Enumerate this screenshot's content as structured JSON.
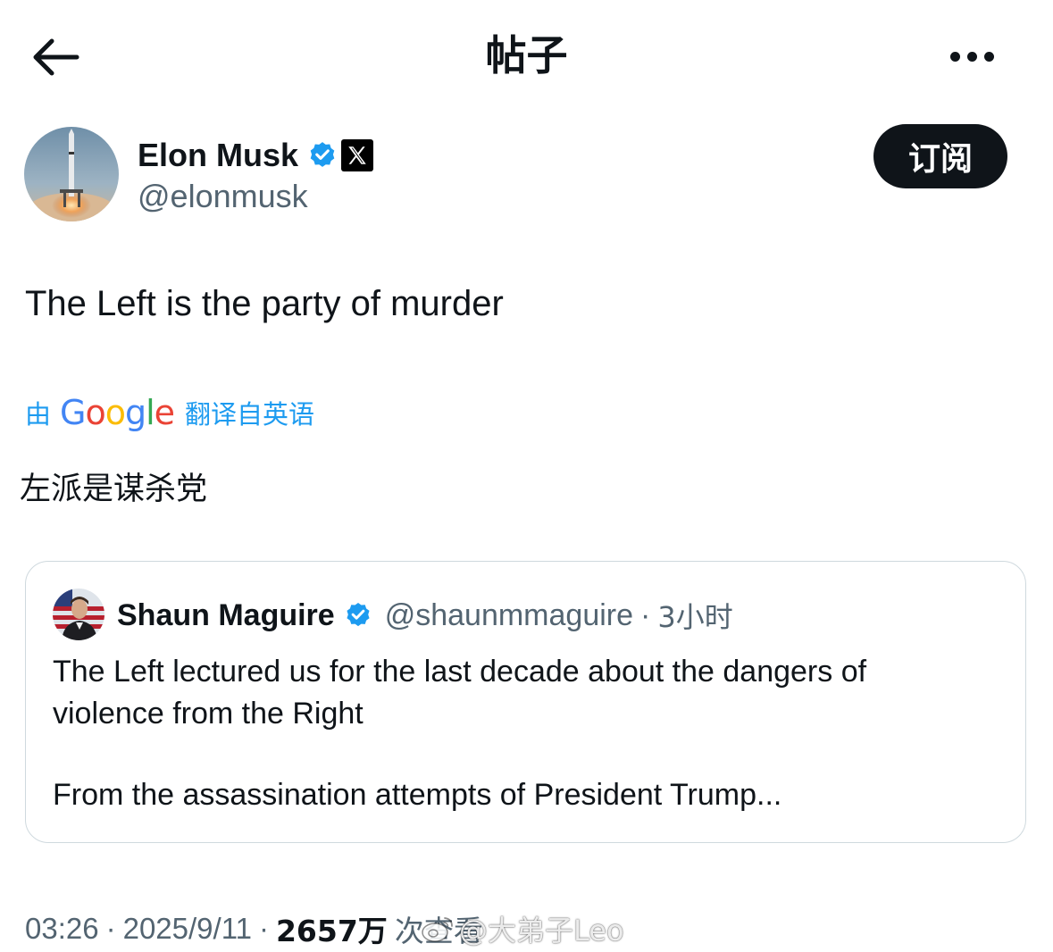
{
  "header": {
    "title": "帖子",
    "back_icon": "arrow-left-icon",
    "more_icon": "more-horizontal-icon"
  },
  "author": {
    "name": "Elon Musk",
    "handle": "@elonmusk",
    "verified_color": "#1d9bf0",
    "affiliate_badge": "x-logo-icon",
    "subscribe_label": "订阅"
  },
  "post": {
    "text": "The Left is the party of murder",
    "translate_by": "由",
    "translate_brand": "Google",
    "translate_from": "翻译自英语",
    "translated_text": "左派是谋杀党"
  },
  "quote": {
    "name": "Shaun Maguire",
    "handle": "@shaunmmaguire",
    "separator": "·",
    "time": "3小时",
    "line1": "The Left lectured us for the last decade about the dangers of",
    "line2": "violence from the Right",
    "line3": "From the assassination attempts of President Trump..."
  },
  "meta": {
    "time": "03:26",
    "separator": "·",
    "date": "2025/9/11",
    "views": "2657万",
    "views_label": "次查看"
  },
  "watermark": {
    "text": "@大弟子Leo"
  },
  "colors": {
    "accent": "#1d9bf0",
    "text_primary": "#0f1419",
    "text_secondary": "#536471",
    "border": "#cfd9de"
  }
}
